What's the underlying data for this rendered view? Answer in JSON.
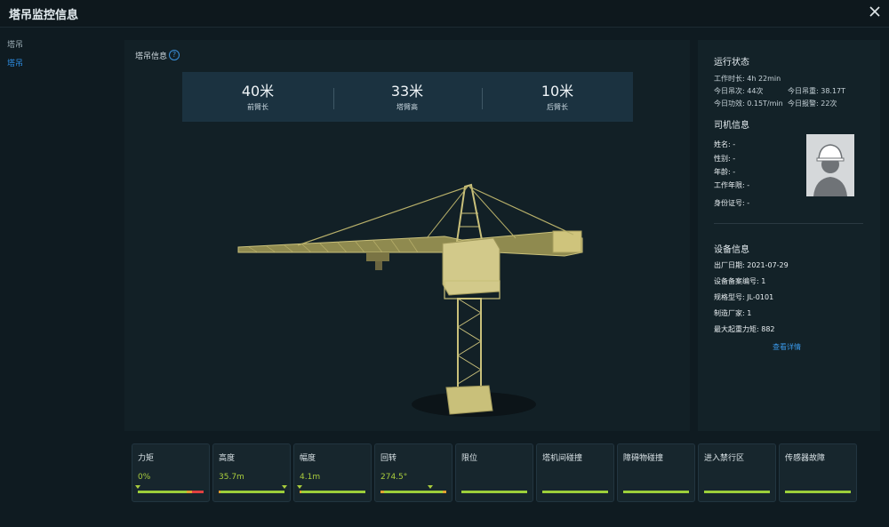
{
  "window": {
    "title": "塔吊监控信息"
  },
  "sidebar": {
    "items": [
      {
        "label": "塔吊",
        "active": false
      },
      {
        "label": "塔吊",
        "active": true
      }
    ]
  },
  "crane_info": {
    "section_label": "塔吊信息",
    "stats": [
      {
        "value": "40米",
        "label": "前臂长"
      },
      {
        "value": "33米",
        "label": "塔臂高"
      },
      {
        "value": "10米",
        "label": "后臂长"
      }
    ]
  },
  "running_status": {
    "title": "运行状态",
    "work_time": "工作时长: 4h 22min",
    "lifts_today": "今日吊次: 44次",
    "weight_today": "今日吊重: 38.17T",
    "efficiency_today": "今日功效: 0.15T/min",
    "alarms_today": "今日报警: 22次"
  },
  "driver_info": {
    "title": "司机信息",
    "name": "姓名: -",
    "gender": "性别: -",
    "age": "年龄: -",
    "work_years": "工作年限: -",
    "id_number": "身份证号: -"
  },
  "device_info": {
    "title": "设备信息",
    "factory_date": "出厂日期: 2021-07-29",
    "record_no": "设备备案编号: 1",
    "model": "规格型号: JL-0101",
    "manufacturer": "制造厂家: 1",
    "max_moment": "最大起重力矩: 882",
    "details_link": "查看详情"
  },
  "monitors": [
    {
      "label": "力矩",
      "value": "0%",
      "level": 0.0
    },
    {
      "label": "高度",
      "value": "35.7m",
      "level": 1.0
    },
    {
      "label": "幅度",
      "value": "4.1m",
      "level": 0.0
    },
    {
      "label": "回转",
      "value": "274.5°",
      "level": 0.76
    },
    {
      "label": "限位",
      "value": ""
    },
    {
      "label": "塔机间碰撞",
      "value": ""
    },
    {
      "label": "障碍物碰撞",
      "value": ""
    },
    {
      "label": "进入禁行区",
      "value": ""
    },
    {
      "label": "传感器故障",
      "value": ""
    }
  ],
  "colors": {
    "accent_blue": "#2e8fe6",
    "ok_green": "#9ccf3a",
    "warn_orange": "#e0a030",
    "alarm_red": "#e04040",
    "crane_olive": "#c9c07a"
  }
}
